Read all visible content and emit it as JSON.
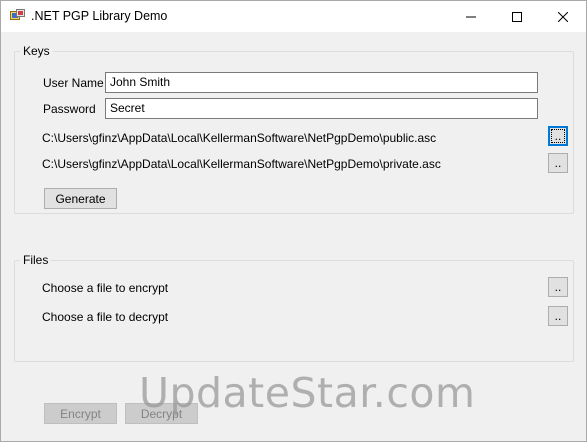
{
  "window": {
    "title": ".NET PGP Library Demo",
    "app_icon": "app-icon",
    "controls": [
      "minimize-icon",
      "maximize-icon",
      "close-icon"
    ]
  },
  "keys": {
    "legend": "Keys",
    "user_name_label": "User Name",
    "user_name_value": "John Smith",
    "password_label": "Password",
    "password_value": "Secret",
    "public_key_path": "C:\\Users\\gfinz\\AppData\\Local\\KellermanSoftware\\NetPgpDemo\\public.asc",
    "private_key_path": "C:\\Users\\gfinz\\AppData\\Local\\KellermanSoftware\\NetPgpDemo\\private.asc",
    "browse_label": "..",
    "generate_label": "Generate"
  },
  "files": {
    "legend": "Files",
    "encrypt_label": "Choose a file to encrypt",
    "decrypt_label": "Choose a file to decrypt",
    "browse_label": ".."
  },
  "actions": {
    "encrypt_label": "Encrypt",
    "decrypt_label": "Decrypt"
  },
  "watermark": "UpdateStar.com",
  "colors": {
    "title_bar": "#ffffff",
    "window_bg": "#f0f0f0",
    "focus_accent": "#0078d7",
    "disabled_text": "#838383"
  }
}
